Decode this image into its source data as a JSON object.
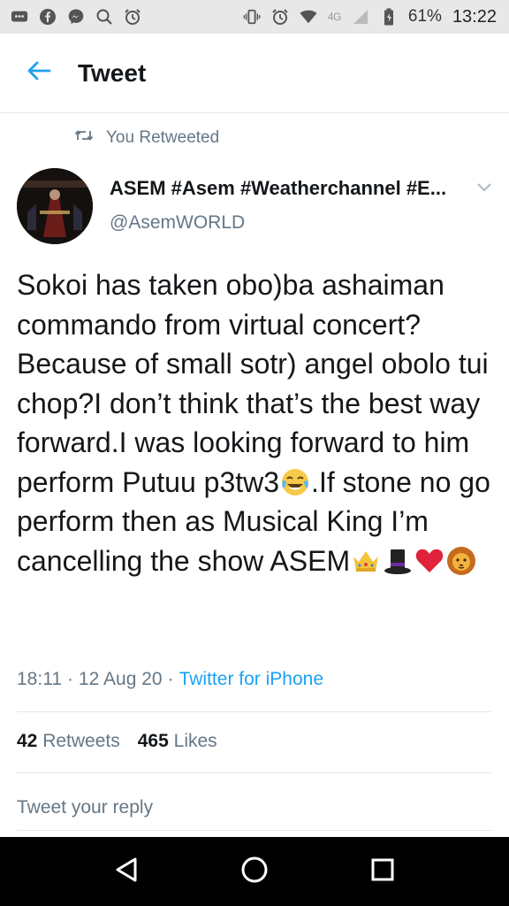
{
  "status_bar": {
    "battery": "61%",
    "time": "13:22",
    "network": "4G"
  },
  "header": {
    "title": "Tweet",
    "back_icon": "arrow-left-icon"
  },
  "retweet_context": {
    "label": "You Retweeted",
    "icon": "retweet-icon"
  },
  "author": {
    "name": "ASEM #Asem #Weatherchannel #E...",
    "handle": "@AsemWORLD"
  },
  "tweet": {
    "text_main": "Sokoi has taken obo)ba ashaiman commando from virtual concert? Because of small sotr) angel obolo tui chop?I don’t think that’s the best way forward.I was looking forward to him perform Putuu p3tw3",
    "text_after_emoji": ".If stone no go perform then as Musical King I’m cancelling the show ASEM",
    "emojis": [
      "tears-of-joy-emoji",
      "crown-emoji",
      "top-hat-emoji",
      "red-heart-emoji",
      "lion-emoji"
    ],
    "time": "18:11",
    "date": "12 Aug 20",
    "separator": "·",
    "source": "Twitter for iPhone"
  },
  "stats": {
    "retweets_count": "42",
    "retweets_label": "Retweets",
    "likes_count": "465",
    "likes_label": "Likes"
  },
  "reply": {
    "placeholder": "Tweet your reply"
  },
  "colors": {
    "accent": "#1da1f2",
    "text": "#14171a",
    "muted": "#657786",
    "divider": "#e1e8ed"
  }
}
